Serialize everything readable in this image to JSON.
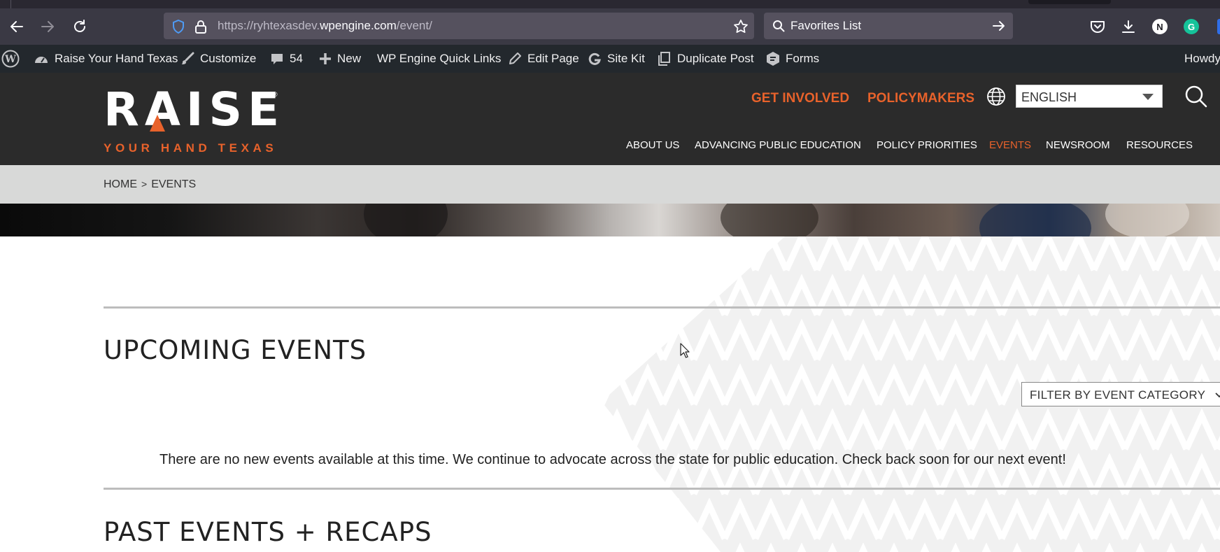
{
  "browser": {
    "url_prefix": "https://ryhtexasdev.",
    "url_host": "wpengine.com",
    "url_suffix": "/event/",
    "search_text": "Favorites List",
    "avatar_n": "N",
    "avatar_g": "G"
  },
  "adminbar": {
    "site_name": "Raise Your Hand Texas",
    "customize": "Customize",
    "comments_count": "54",
    "new": "New",
    "quick_links": "WP Engine Quick Links",
    "edit_page": "Edit Page",
    "site_kit": "Site Kit",
    "duplicate_post": "Duplicate Post",
    "forms": "Forms",
    "howdy": "Howdy"
  },
  "header": {
    "logo_main": "RAISE",
    "logo_sub": "YOUR HAND TEXAS",
    "logo_reg": "®",
    "get_involved": "GET INVOLVED",
    "policymakers": "POLICYMAKERS",
    "language": "ENGLISH",
    "nav": [
      "ABOUT US",
      "ADVANCING PUBLIC EDUCATION",
      "POLICY PRIORITIES",
      "EVENTS",
      "NEWSROOM",
      "RESOURCES"
    ],
    "accent_color": "#e8622b"
  },
  "breadcrumb": {
    "home": "HOME",
    "separator": ">",
    "current": "EVENTS"
  },
  "content": {
    "upcoming_title": "UPCOMING EVENTS",
    "filter_label": "FILTER BY EVENT CATEGORY",
    "no_events": "There are no new events available at this time. We continue to advocate across the state for public education. Check back soon for our next event!",
    "past_title": "PAST EVENTS + RECAPS"
  }
}
